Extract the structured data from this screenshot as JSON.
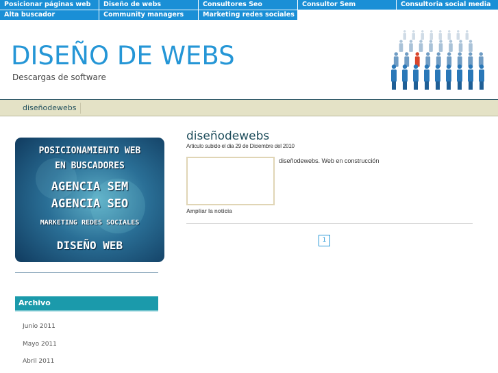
{
  "top_nav": {
    "items": [
      {
        "label": "Posicionar páginas web"
      },
      {
        "label": "Diseño de webs"
      },
      {
        "label": "Consultores Seo"
      },
      {
        "label": "Consultor Sem"
      },
      {
        "label": "Consultoria social media"
      },
      {
        "label": "Alta buscador"
      },
      {
        "label": "Community managers"
      },
      {
        "label": "Marketing redes sociales"
      }
    ],
    "color": "#1a8fd6"
  },
  "header": {
    "title": "DISEÑO DE WEBS",
    "subtitle": "Descargas de software",
    "graphic_icon": "people-crowd-icon",
    "title_color": "#2596d6"
  },
  "menu": {
    "items": [
      {
        "label": "diseñodewebs"
      }
    ],
    "background": "#e4e2c6"
  },
  "sidebar": {
    "banner": {
      "lines": [
        "POSICIONAMIENTO WEB",
        "EN BUSCADORES",
        "AGENCIA SEM",
        "AGENCIA SEO",
        "MARKETING REDES SOCIALES",
        "DISEÑO WEB"
      ]
    },
    "archive": {
      "heading": "Archivo",
      "links": [
        "Junio 2011",
        "Mayo 2011",
        "Abril 2011"
      ],
      "color": "#1b9aab"
    }
  },
  "post": {
    "title": "diseñodewebs",
    "meta": "Articulo subido el dia 29 de Diciembre del 2010",
    "excerpt": "diseñodewebs. Web en construcción",
    "read_more": "Ampliar la noticia"
  },
  "pagination": {
    "current_page": "1"
  }
}
